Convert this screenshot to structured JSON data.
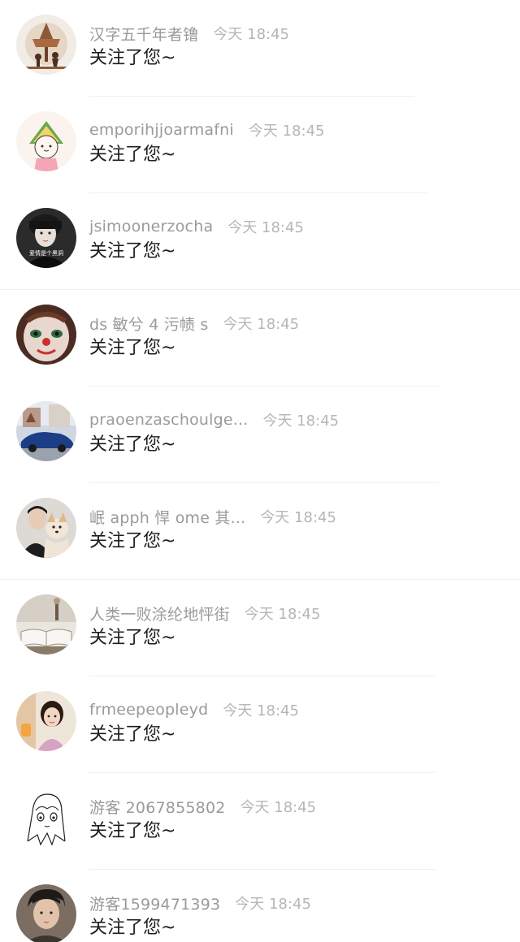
{
  "notifications": [
    {
      "name": "汉字五千年者镥",
      "time": "今天 18:45",
      "message": "关注了您~",
      "avatar_icon": "avatar-silhouette-tree"
    },
    {
      "name": "emporihjjoarmafni",
      "time": "今天 18:45",
      "message": "关注了您~",
      "avatar_icon": "avatar-watermelon-cartoon"
    },
    {
      "name": "jsimoonerzocha",
      "time": "今天 18:45",
      "message": "关注了您~",
      "avatar_icon": "avatar-dark-portrait"
    },
    {
      "name": "ds 敏兮 4 污帻 s",
      "time": "今天 18:45",
      "message": "关注了您~",
      "avatar_icon": "avatar-clown-face"
    },
    {
      "name": "praoenzaschoulge...",
      "time": "今天 18:45",
      "message": "关注了您~",
      "avatar_icon": "avatar-blue-car"
    },
    {
      "name": "岷 apph 悍 ome 其...",
      "time": "今天 18:45",
      "message": "关注了您~",
      "avatar_icon": "avatar-person-with-dog"
    },
    {
      "name": "人类一败涂纶地怦街",
      "time": "今天 18:45",
      "message": "关注了您~",
      "avatar_icon": "avatar-open-book"
    },
    {
      "name": "frmeepeopleyd",
      "time": "今天 18:45",
      "message": "关注了您~",
      "avatar_icon": "avatar-girl-photo"
    },
    {
      "name": "游客 2067855802",
      "time": "今天 18:45",
      "message": "关注了您~",
      "avatar_icon": "avatar-anime-sketch"
    },
    {
      "name": "游客1599471393",
      "time": "今天 18:45",
      "message": "关注了您~",
      "avatar_icon": "avatar-boy-photo"
    }
  ]
}
